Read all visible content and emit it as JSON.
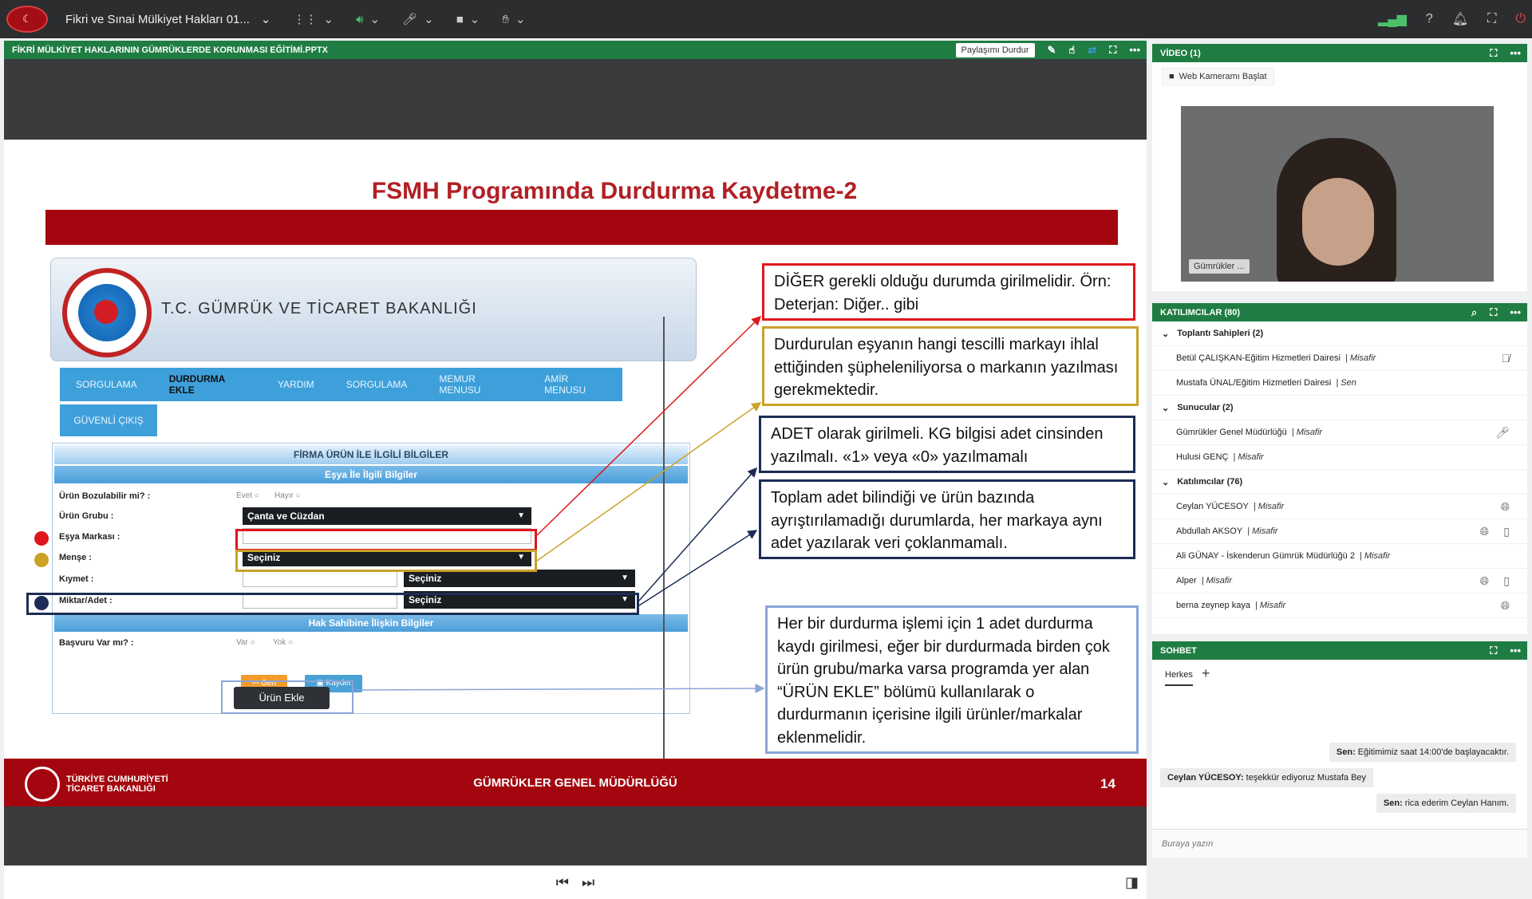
{
  "topbar": {
    "meeting_title": "Fikri ve Sınai Mülkiyet Hakları 01..."
  },
  "share": {
    "title": "FİKRİ MÜLKİYET HAKLARININ GÜMRÜKLERDE KORUNMASI EĞİTİMİ.PPTX",
    "stop_label": "Paylaşımı Durdur"
  },
  "slide": {
    "title": "FSMH Programında Durdurma Kaydetme-2",
    "app_name": "T.C. GÜMRÜK VE TİCARET BAKANLIĞI",
    "nav": [
      "SORGULAMA",
      "DURDURMA EKLE",
      "YARDIM",
      "SORGULAMA",
      "MEMUR MENUSU",
      "AMİR MENUSU"
    ],
    "nav2": "GÜVENLİ ÇIKIŞ",
    "form_header": "FİRMA ÜRÜN İLE İLGİLİ BİLGİLER",
    "section1": "Eşya İle İlgili Bilgiler",
    "section2": "Hak Sahibine İlişkin Bilgiler",
    "labels": {
      "bozulabilir": "Ürün Bozulabilir mi? :",
      "grup": "Ürün Grubu :",
      "marka": "Eşya Markası :",
      "mense": "Menşe :",
      "kiymet": "Kıymet :",
      "miktar": "Miktar/Adet :",
      "basvuru": "Başvuru Var mı? :"
    },
    "radios": {
      "evet": "Evet",
      "hayir": "Hayır",
      "var": "Var",
      "yok": "Yok"
    },
    "values": {
      "grup": "Çanta ve Cüzdan",
      "select": "Seçiniz"
    },
    "buttons": {
      "urun_ekle": "Ürün Ekle",
      "geri": "Geri",
      "kaydet": "Kaydet"
    },
    "notes": [
      "DİĞER gerekli olduğu durumda girilmelidir. Örn: Deterjan: Diğer.. gibi",
      "Durdurulan eşyanın hangi tescilli markayı ihlal ettiğinden şüpheleniliyorsa o markanın yazılması gerekmektedir.",
      "ADET olarak girilmeli. KG bilgisi adet cinsinden yazılmalı. «1» veya «0» yazılmamalı",
      "Toplam adet bilindiği ve ürün bazında ayrıştırılamadığı durumlarda, her markaya aynı adet yazılarak veri çoklanmamalı.",
      "Her bir durdurma işlemi için 1 adet durdurma kaydı girilmesi, eğer bir durdurmada birden çok ürün grubu/marka varsa programda yer alan “ÜRÜN EKLE” bölümü kullanılarak o durdurmanın içerisine ilgili ürünler/markalar eklenmelidir."
    ],
    "footer": {
      "org_line1": "TÜRKİYE CUMHURİYETİ",
      "org_line2": "TİCARET BAKANLIĞI",
      "center": "GÜMRÜKLER GENEL MÜDÜRLÜĞÜ",
      "page": "14"
    }
  },
  "video": {
    "title": "VİDEO (1)",
    "start_cam": "Web Kameramı Başlat",
    "label": "Gümrükler ..."
  },
  "participants": {
    "title": "KATILIMCILAR  (80)",
    "rows": [
      {
        "type": "group",
        "name": "Toplantı Sahipleri (2)"
      },
      {
        "name": "Betül ÇALIŞKAN-Eğitim Hizmetleri Dairesi",
        "role": "| Misafir",
        "icon": "mic-off"
      },
      {
        "name": "Mustafa ÜNAL/Eğitim Hizmetleri Dairesi",
        "role": "| Sen",
        "icon": ""
      },
      {
        "type": "group",
        "name": "Sunucular (2)"
      },
      {
        "name": "Gümrükler Genel Müdürlüğü",
        "role": "| Misafir",
        "icon": "mic"
      },
      {
        "name": "Hulusi GENÇ",
        "role": "| Misafir",
        "icon": ""
      },
      {
        "type": "group",
        "name": "Katılımcılar (76)"
      },
      {
        "name": "Ceylan YÜCESOY",
        "role": "| Misafir",
        "icon": "globe"
      },
      {
        "name": "Abdullah AKSOY",
        "role": "| Misafir",
        "icon": "globe-phone"
      },
      {
        "name": "Ali GÜNAY - İskenderun Gümrük Müdürlüğü 2",
        "role": "| Misafir",
        "icon": ""
      },
      {
        "name": "Alper",
        "role": "| Misafir",
        "icon": "globe-phone"
      },
      {
        "name": "berna zeynep kaya",
        "role": "| Misafir",
        "icon": "globe"
      }
    ]
  },
  "chat": {
    "title": "SOHBET",
    "tab": "Herkes",
    "placeholder": "Buraya yazın",
    "messages": [
      {
        "who": "Sen:",
        "text": "Eğitimimiz saat 14:00'de başlayacaktır."
      },
      {
        "who": "Ceylan YÜCESOY:",
        "text": "teşekkür ediyoruz Mustafa Bey"
      },
      {
        "who": "Sen:",
        "text": "rica ederim Ceylan Hanım."
      }
    ]
  }
}
